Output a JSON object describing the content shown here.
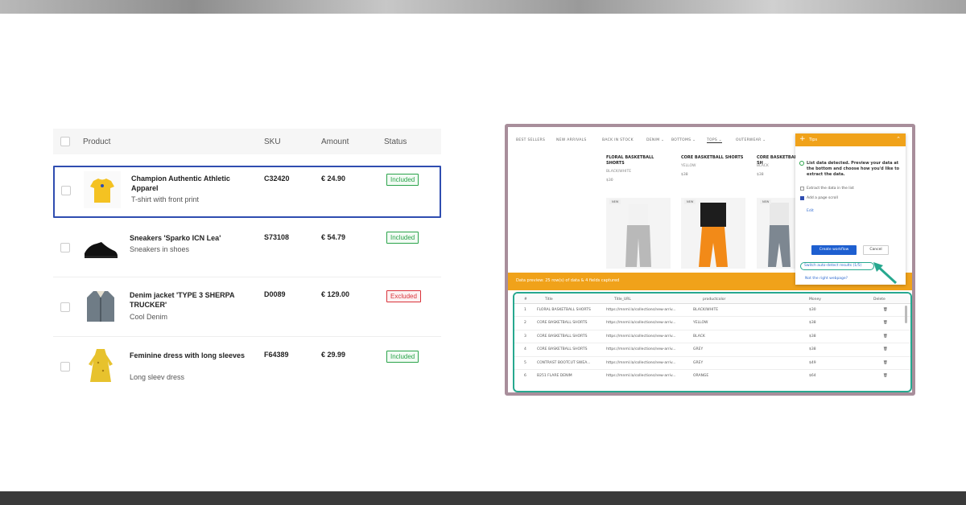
{
  "products": {
    "headers": {
      "product": "Product",
      "sku": "SKU",
      "amount": "Amount",
      "status": "Status"
    },
    "rows": [
      {
        "name": "Champion Authentic Athletic Apparel",
        "desc": "T-shirt with front print",
        "sku": "C32420",
        "amount": "€ 24.90",
        "status": "Included",
        "status_color": "#2aa34a"
      },
      {
        "name": "Sneakers 'Sparko ICN Lea'",
        "desc": "Sneakers in shoes",
        "sku": "S73108",
        "amount": "€ 54.79",
        "status": "Included",
        "status_color": "#2aa34a"
      },
      {
        "name": "Denim jacket 'TYPE 3 SHERPA TRUCKER'",
        "desc": "Cool Denim",
        "sku": "D0089",
        "amount": "€ 129.00",
        "status": "Excluded",
        "status_color": "#d9323a"
      },
      {
        "name": "Feminine dress with long sleeves",
        "desc": "Long sleev dress",
        "sku": "F64389",
        "amount": "€ 29.99",
        "status": "Included",
        "status_color": "#2aa34a"
      }
    ]
  },
  "shop": {
    "nav": [
      "BEST SELLERS",
      "NEW ARRIVALS",
      "BACK IN STOCK",
      "DENIM ⌄",
      "BOTTOMS ⌄",
      "TOPS ⌄",
      "OUTERWEAR ⌄"
    ],
    "grid": [
      {
        "title": "FLORAL BASKETBALL SHORTS",
        "color": "BLACK/WHITE",
        "price": "$30",
        "tag": "NEW"
      },
      {
        "title": "CORE BASKETBALL SHORTS",
        "color": "YELLOW",
        "price": "$38",
        "tag": "NEW"
      },
      {
        "title": "CORE BASKETBALL SH",
        "color": "BLACK",
        "price": "$38",
        "tag": "NEW"
      }
    ],
    "preview_text": "Data preview: 25 row(s) of data & 4 fields captured"
  },
  "tip": {
    "title": "Tips",
    "message": "List data detected. Preview your data at the bottom and choose how you'd like to extract the data.",
    "option1": "Extract the data in the list",
    "option2": "Add a page scroll",
    "edit": "Edit",
    "create": "Create workflow",
    "cancel": "Cancel",
    "switch": "Switch auto-detect results (1/5)",
    "not_right": "Not the right webpage?"
  },
  "datatable": {
    "headers": [
      "#",
      "Title",
      "Title_URL",
      "productcolor",
      "Money",
      "Delete"
    ],
    "rows": [
      {
        "n": "1",
        "title": "FLORAL BASKETBALL SHORTS",
        "url": "https://mnml.la/collections/new-arriv...",
        "color": "BLACK/WHITE",
        "money": "$30"
      },
      {
        "n": "2",
        "title": "CORE BASKETBALL SHORTS",
        "url": "https://mnml.la/collections/new-arriv...",
        "color": "YELLOW",
        "money": "$38"
      },
      {
        "n": "3",
        "title": "CORE BASKETBALL SHORTS",
        "url": "https://mnml.la/collections/new-arriv...",
        "color": "BLACK",
        "money": "$38"
      },
      {
        "n": "4",
        "title": "CORE BASKETBALL SHORTS",
        "url": "https://mnml.la/collections/new-arriv...",
        "color": "GREY",
        "money": "$38"
      },
      {
        "n": "5",
        "title": "CONTRAST BOOTCUT SWEA...",
        "url": "https://mnml.la/collections/new-arriv...",
        "color": "GREY",
        "money": "$49"
      },
      {
        "n": "6",
        "title": "B251 FLARE DENIM",
        "url": "https://mnml.la/collections/new-arriv...",
        "color": "ORANGE",
        "money": "$64"
      }
    ]
  }
}
